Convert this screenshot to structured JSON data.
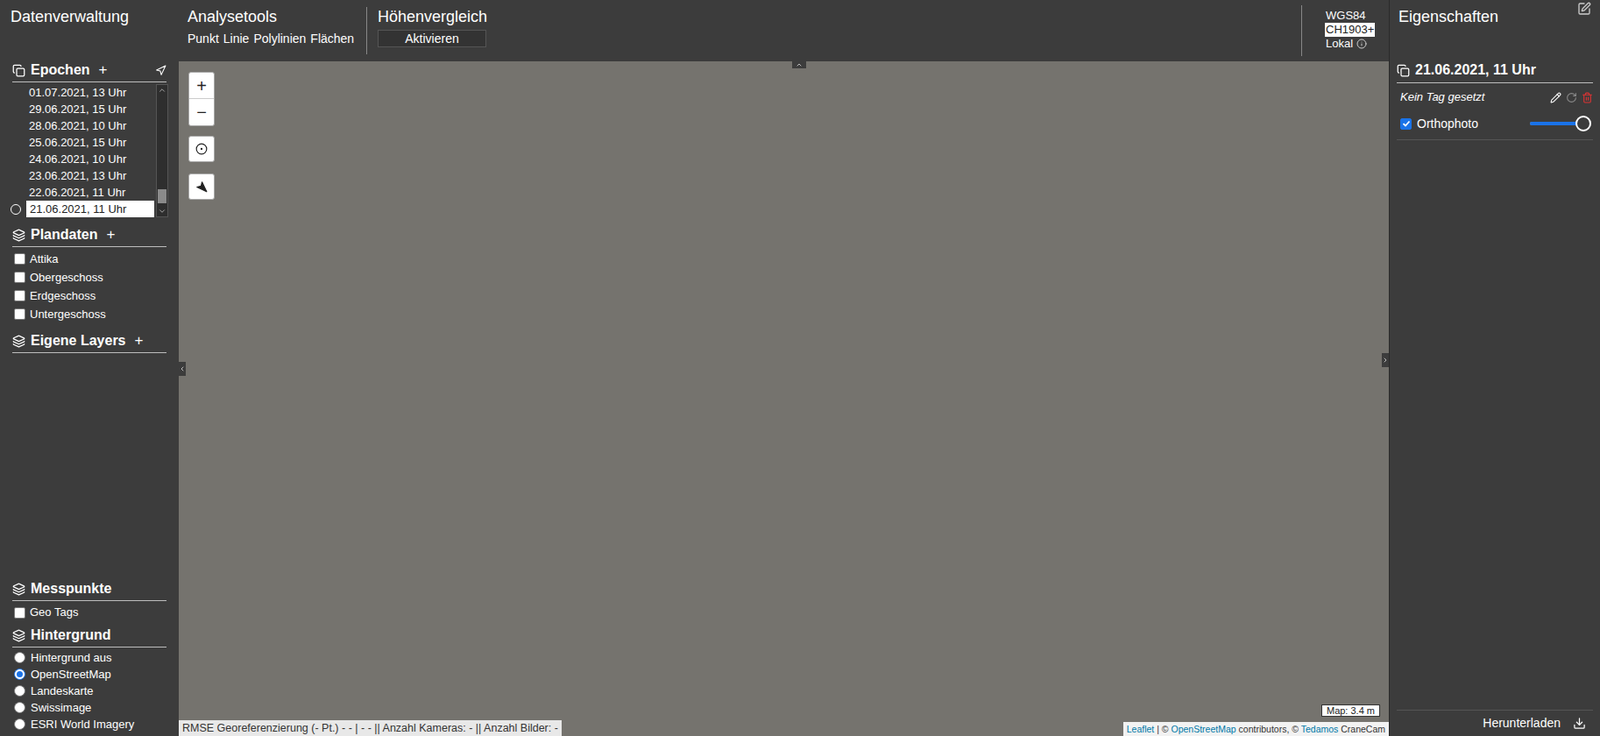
{
  "data_management": {
    "title": "Datenverwaltung"
  },
  "analysis_tools": {
    "title": "Analysetools",
    "tools": [
      "Punkt",
      "Linie",
      "Polylinien",
      "Flächen"
    ]
  },
  "height_comparison": {
    "title": "Höhenvergleich",
    "button": "Aktivieren"
  },
  "coordinate_systems": [
    {
      "label": "WGS84",
      "selected": false
    },
    {
      "label": "CH1903+",
      "selected": true
    },
    {
      "label": "Lokal",
      "selected": false
    }
  ],
  "epochs": {
    "title": "Epochen",
    "add": "+",
    "items": [
      {
        "label": "01.07.2021, 13 Uhr",
        "selected": false
      },
      {
        "label": "29.06.2021, 15 Uhr",
        "selected": false
      },
      {
        "label": "28.06.2021, 10 Uhr",
        "selected": false
      },
      {
        "label": "25.06.2021, 15 Uhr",
        "selected": false
      },
      {
        "label": "24.06.2021, 10 Uhr",
        "selected": false
      },
      {
        "label": "23.06.2021, 13 Uhr",
        "selected": false
      },
      {
        "label": "22.06.2021, 11 Uhr",
        "selected": false
      },
      {
        "label": "21.06.2021, 11 Uhr",
        "selected": true
      }
    ]
  },
  "plan_data": {
    "title": "Plandaten",
    "add": "+",
    "items": [
      {
        "label": "Attika",
        "checked": false
      },
      {
        "label": "Obergeschoss",
        "checked": false
      },
      {
        "label": "Erdgeschoss",
        "checked": false
      },
      {
        "label": "Untergeschoss",
        "checked": false
      }
    ]
  },
  "own_layers": {
    "title": "Eigene Layers",
    "add": "+"
  },
  "measuring_points": {
    "title": "Messpunkte",
    "items": [
      {
        "label": "Geo Tags",
        "checked": false
      }
    ]
  },
  "background": {
    "title": "Hintergrund",
    "options": [
      {
        "label": "Hintergrund aus",
        "selected": false
      },
      {
        "label": "OpenStreetMap",
        "selected": true
      },
      {
        "label": "Landeskarte",
        "selected": false
      },
      {
        "label": "Swissimage",
        "selected": false
      },
      {
        "label": "ESRI World Imagery",
        "selected": false
      }
    ]
  },
  "map": {
    "zoom_in": "+",
    "zoom_out": "−",
    "scale": "Map: 3.4 m",
    "status": "RMSE Georeferenzierung (- Pt.) - - | - - || Anzahl Kameras: - || Anzahl Bilder: -",
    "attribution": [
      {
        "text": "Leaflet",
        "link": true
      },
      {
        "text": " | © ",
        "link": false
      },
      {
        "text": "OpenStreetMap",
        "link": true
      },
      {
        "text": " contributors, © ",
        "link": false
      },
      {
        "text": "Tedamos",
        "link": true
      },
      {
        "text": " CraneCam",
        "link": false
      }
    ]
  },
  "properties": {
    "title": "Eigenschaften",
    "epoch": "21.06.2021, 11 Uhr",
    "tag": "Kein Tag gesetzt",
    "layers": [
      {
        "label": "Orthophoto",
        "checked": true,
        "level": 1.0
      }
    ],
    "download": "Herunterladen"
  }
}
